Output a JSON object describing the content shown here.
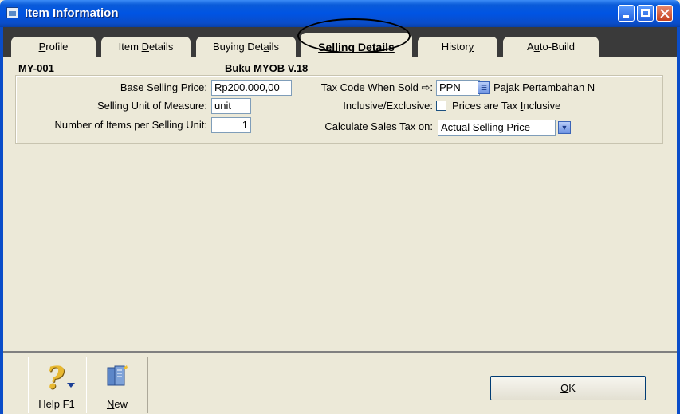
{
  "window": {
    "title": "Item Information"
  },
  "tabs": {
    "profile_u": "P",
    "profile_rest": "rofile",
    "item_pre": "Item ",
    "item_u": "D",
    "item_rest": "etails",
    "buying_pre": "Buying Det",
    "buying_u": "a",
    "buying_rest": "ils",
    "selling": "Selling Details",
    "history_pre": "Histor",
    "history_u": "y",
    "autobuild_pre": "A",
    "autobuild_u": "u",
    "autobuild_rest": "to-Build",
    "active": "Selling Details"
  },
  "item": {
    "code": "MY-001",
    "name": "Buku MYOB V.18"
  },
  "selling": {
    "base_price_label": "Base Selling Price:",
    "base_price_value": "Rp200.000,00",
    "unit_label": "Selling Unit of Measure:",
    "unit_value": "unit",
    "items_per_unit_label": "Number of Items per Selling Unit:",
    "items_per_unit_value": "1",
    "tax_code_label": "Tax Code When Sold ⇨:",
    "tax_code_value": "PPN",
    "tax_code_desc": "Pajak Pertambahan N",
    "inclusive_label": "Inclusive/Exclusive:",
    "inclusive_check_pre": "Prices are Tax ",
    "inclusive_check_u": "I",
    "inclusive_check_rest": "nclusive",
    "inclusive_checked": false,
    "calc_label": "Calculate Sales Tax on:",
    "calc_value": "Actual Selling Price"
  },
  "footer": {
    "help_label": "Help F1",
    "new_u": "N",
    "new_rest": "ew",
    "ok_u": "O",
    "ok_rest": "K"
  },
  "icons": {
    "app": "window-app-icon",
    "help": "question-mark-icon",
    "new": "new-document-icon"
  },
  "colors": {
    "titlebar": "#0054e3",
    "window_bg": "#ece9d8",
    "tabstrip_bg": "#3a3a3a"
  }
}
